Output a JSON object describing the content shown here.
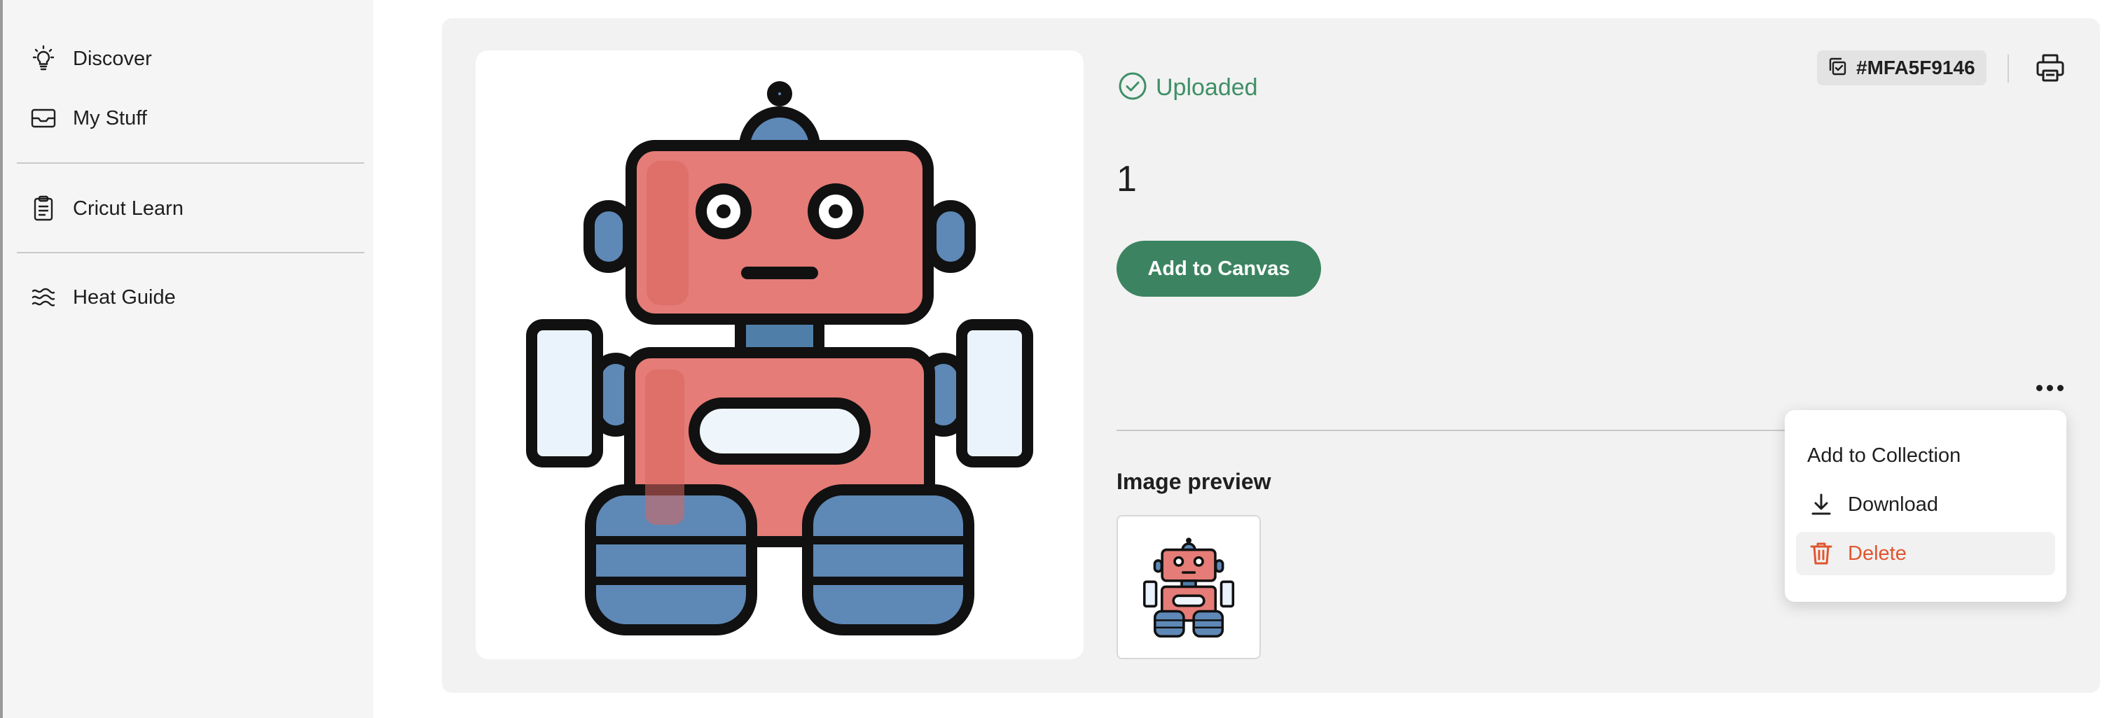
{
  "sidebar": {
    "items": [
      {
        "label": "Discover",
        "icon": "lightbulb-icon"
      },
      {
        "label": "My Stuff",
        "icon": "inbox-icon"
      },
      {
        "label": "Cricut Learn",
        "icon": "clipboard-icon"
      },
      {
        "label": "Heat Guide",
        "icon": "heat-waves-icon"
      }
    ]
  },
  "design": {
    "status": "Uploaded",
    "name": "1",
    "id": "#MFA5F9146",
    "add_to_canvas_label": "Add to Canvas",
    "preview_title": "Image preview"
  },
  "menu": {
    "items": [
      {
        "label": "Add to Collection"
      },
      {
        "label": "Download",
        "icon": "download-icon"
      },
      {
        "label": "Delete",
        "icon": "trash-icon"
      }
    ]
  },
  "colors": {
    "accent": "#3c8461",
    "status": "#3f8f66",
    "danger": "#e0562f",
    "robot_body": "#e57c77",
    "robot_blue": "#5e88b6"
  }
}
